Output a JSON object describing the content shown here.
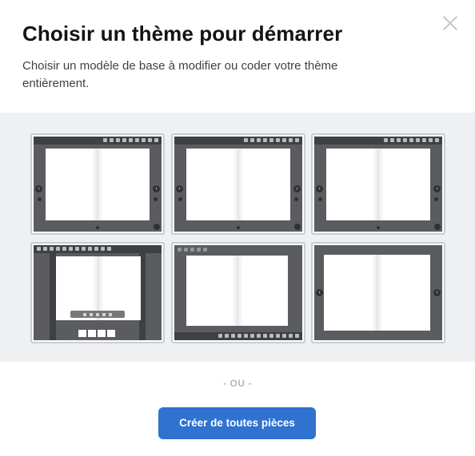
{
  "dialog": {
    "title": "Choisir un thème pour démarrer",
    "subtitle": "Choisir un modèle de base à modifier ou coder votre thème entièrement.",
    "close_icon": "close-icon"
  },
  "themes": [
    {
      "name": "theme-1"
    },
    {
      "name": "theme-2"
    },
    {
      "name": "theme-3"
    },
    {
      "name": "theme-4"
    },
    {
      "name": "theme-5"
    },
    {
      "name": "theme-6"
    }
  ],
  "divider": {
    "label": "- OU -"
  },
  "cta": {
    "label": "Créer de toutes pièces",
    "color": "#2f72d0"
  }
}
